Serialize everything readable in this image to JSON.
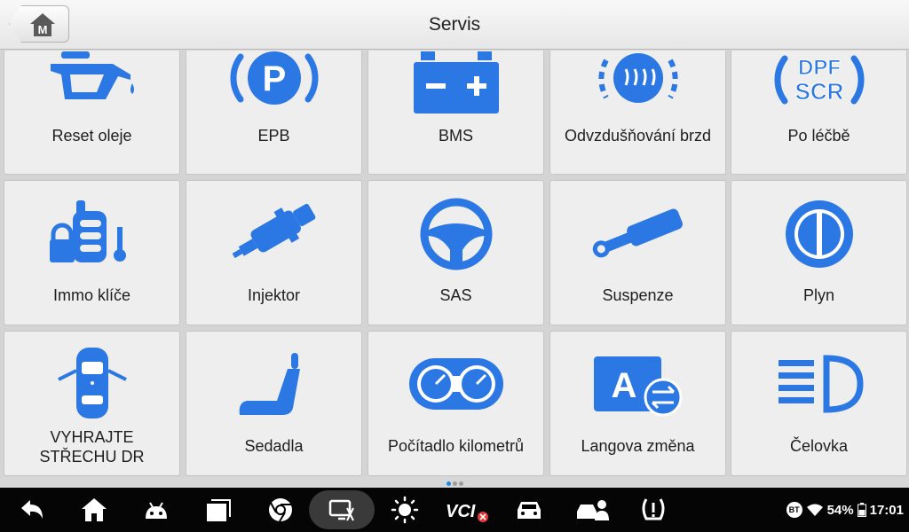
{
  "header": {
    "title": "Servis",
    "home_letter": "M"
  },
  "tiles": [
    {
      "label": "Reset oleje",
      "icon": "oil-can-icon"
    },
    {
      "label": "EPB",
      "icon": "parking-brake-icon"
    },
    {
      "label": "BMS",
      "icon": "battery-icon"
    },
    {
      "label": "Odvzdušňování brzd",
      "icon": "brake-bleed-icon"
    },
    {
      "label": "Po léčbě",
      "icon": "dpf-scr-icon",
      "icon_text_1": "DPF",
      "icon_text_2": "SCR"
    },
    {
      "label": "Immo klíče",
      "icon": "immo-key-icon"
    },
    {
      "label": "Injektor",
      "icon": "injector-icon"
    },
    {
      "label": "SAS",
      "icon": "steering-wheel-icon"
    },
    {
      "label": "Suspenze",
      "icon": "suspension-icon"
    },
    {
      "label": "Plyn",
      "icon": "throttle-icon"
    },
    {
      "label_line1": "VYHRAJTE",
      "label_line2": "STŘECHU DR",
      "icon": "car-roof-icon"
    },
    {
      "label": "Sedadla",
      "icon": "seat-icon"
    },
    {
      "label": "Počítadlo kilometrů",
      "icon": "odometer-icon"
    },
    {
      "label": "Langova změna",
      "icon": "language-icon"
    },
    {
      "label": "Čelovka",
      "icon": "headlight-icon"
    }
  ],
  "pagination": {
    "count": 3,
    "active": 0
  },
  "navbar": {
    "icons": [
      "back-icon",
      "home-icon",
      "android-icon",
      "recent-apps-icon",
      "chrome-icon",
      "screen-capture-icon",
      "brightness-icon",
      "vci-icon",
      "car-icon",
      "remote-expert-icon",
      "tpms-icon"
    ],
    "vci_label": "VCI",
    "bt_label": "BT",
    "battery": "54%",
    "time": "17:01"
  },
  "colors": {
    "icon_blue": "#2b78e4",
    "tile_bg": "#eeeeee",
    "navbar_bg": "#050505"
  }
}
